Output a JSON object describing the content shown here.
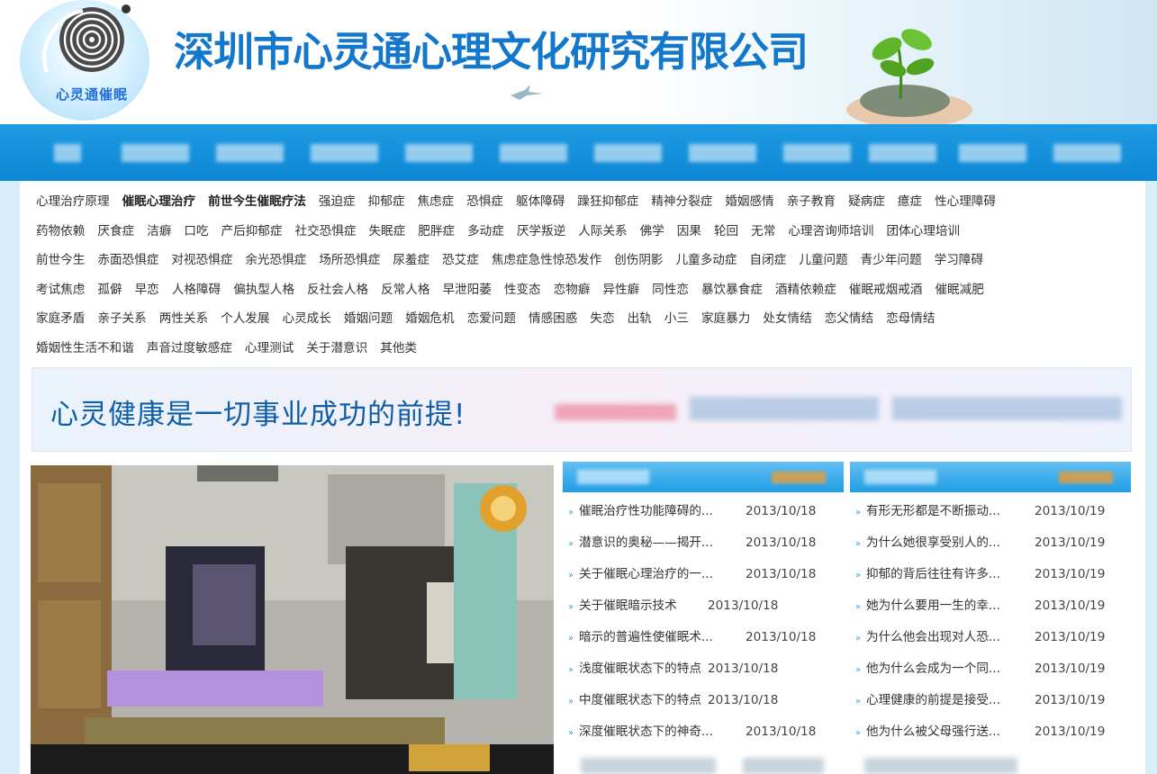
{
  "header": {
    "logo_text": "心灵通催眠",
    "company_name": "深圳市心灵通心理文化研究有限公司"
  },
  "tags": [
    [
      "心理治疗原理",
      "催眠心理治疗",
      "前世今生催眠疗法",
      "强迫症",
      "抑郁症",
      "焦虑症",
      "恐惧症",
      "躯体障碍",
      "躁狂抑郁症",
      "精神分裂症",
      "婚姻感情",
      "亲子教育",
      "疑病症",
      "癔症",
      "性心理障碍"
    ],
    [
      "药物依赖",
      "厌食症",
      "洁癖",
      "口吃",
      "产后抑郁症",
      "社交恐惧症",
      "失眠症",
      "肥胖症",
      "多动症",
      "厌学叛逆",
      "人际关系",
      "佛学",
      "因果",
      "轮回",
      "无常",
      "心理咨询师培训",
      "团体心理培训"
    ],
    [
      "前世今生",
      "赤面恐惧症",
      "对视恐惧症",
      "余光恐惧症",
      "场所恐惧症",
      "尿羞症",
      "恐艾症",
      "焦虑症急性惊恐发作",
      "创伤阴影",
      "儿童多动症",
      "自闭症",
      "儿童问题",
      "青少年问题",
      "学习障碍"
    ],
    [
      "考试焦虑",
      "孤僻",
      "早恋",
      "人格障碍",
      "偏执型人格",
      "反社会人格",
      "反常人格",
      "早泄阳萎",
      "性变态",
      "恋物癖",
      "异性癖",
      "同性恋",
      "暴饮暴食症",
      "酒精依赖症",
      "催眠戒烟戒酒",
      "催眠减肥"
    ],
    [
      "家庭矛盾",
      "亲子关系",
      "两性关系",
      "个人发展",
      "心灵成长",
      "婚姻问题",
      "婚姻危机",
      "恋爱问题",
      "情感困惑",
      "失恋",
      "出轨",
      "小三",
      "家庭暴力",
      "处女情结",
      "恋父情结",
      "恋母情结"
    ],
    [
      "婚姻性生活不和谐",
      "声音过度敏感症",
      "心理测试",
      "关于潜意识",
      "其他类"
    ]
  ],
  "banner": {
    "slogan": "心灵健康是一切事业成功的前提!"
  },
  "left_list": [
    {
      "title": "催眠治疗性功能障碍的...",
      "date": "2013/10/18"
    },
    {
      "title": "潜意识的奥秘——揭开...",
      "date": "2013/10/18"
    },
    {
      "title": "关于催眠心理治疗的一...",
      "date": "2013/10/18"
    },
    {
      "title": "关于催眠暗示技术",
      "date": "2013/10/18"
    },
    {
      "title": "暗示的普遍性使催眠术...",
      "date": "2013/10/18"
    },
    {
      "title": "浅度催眠状态下的特点",
      "date": "2013/10/18"
    },
    {
      "title": "中度催眠状态下的特点",
      "date": "2013/10/18"
    },
    {
      "title": "深度催眠状态下的神奇...",
      "date": "2013/10/18"
    }
  ],
  "right_list": [
    {
      "title": "有形无形都是不断振动...",
      "date": "2013/10/19"
    },
    {
      "title": "为什么她很享受别人的...",
      "date": "2013/10/19"
    },
    {
      "title": "抑郁的背后往往有许多...",
      "date": "2013/10/19"
    },
    {
      "title": "她为什么要用一生的幸...",
      "date": "2013/10/19"
    },
    {
      "title": "为什么他会出现对人恐...",
      "date": "2013/10/19"
    },
    {
      "title": "他为什么会成为一个同...",
      "date": "2013/10/19"
    },
    {
      "title": "心理健康的前提是接受...",
      "date": "2013/10/19"
    },
    {
      "title": "他为什么被父母强行送...",
      "date": "2013/10/19"
    }
  ]
}
